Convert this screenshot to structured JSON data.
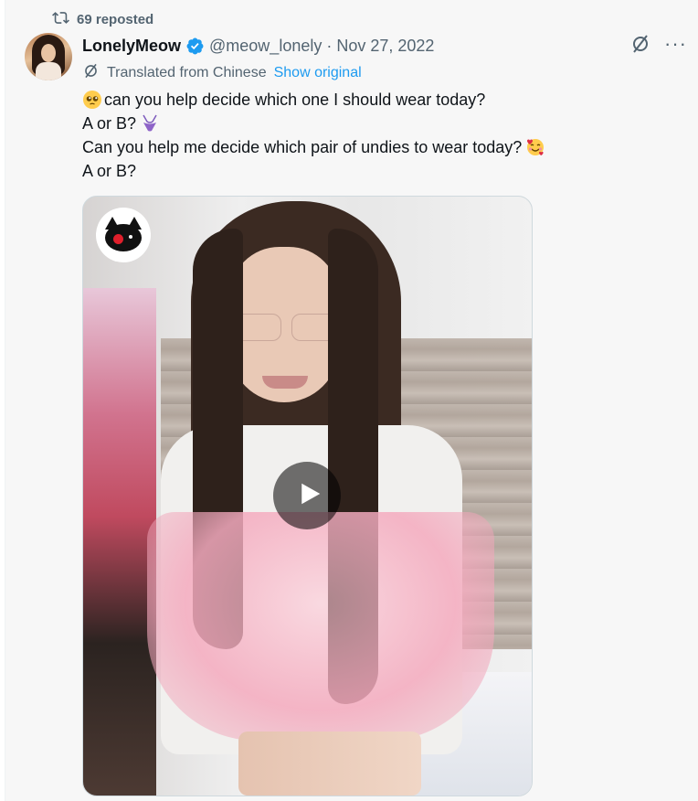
{
  "repost": {
    "label": "69 reposted",
    "icon": "repost-icon"
  },
  "author": {
    "name": "LonelyMeow",
    "verified": true,
    "handle": "@meow_lonely",
    "separator": "·",
    "date": "Nov 27, 2022",
    "avatar": "avatar-photo"
  },
  "actions": {
    "grok_icon": "grok-icon",
    "more_label": "···"
  },
  "translation": {
    "label": "Translated from Chinese",
    "show_original": "Show original",
    "icon": "translate-icon"
  },
  "text": {
    "line1": "can you help decide which one I should wear today?",
    "line1_emoji": "pleading-face-emoji",
    "line2": "A or B?",
    "line2_emoji": "bikini-emoji",
    "line3": "Can you help me decide which pair of undies to wear today?",
    "line3_emoji": "smiling-face-with-hearts-emoji",
    "line4": "A or B?"
  },
  "media": {
    "type": "video",
    "watermark": "lonely-meow-cat-logo",
    "play_icon": "play-icon"
  },
  "colors": {
    "accent": "#1d9bf0",
    "secondary_text": "#536471",
    "primary_text": "#0f1419",
    "background": "#f7f7f7"
  }
}
